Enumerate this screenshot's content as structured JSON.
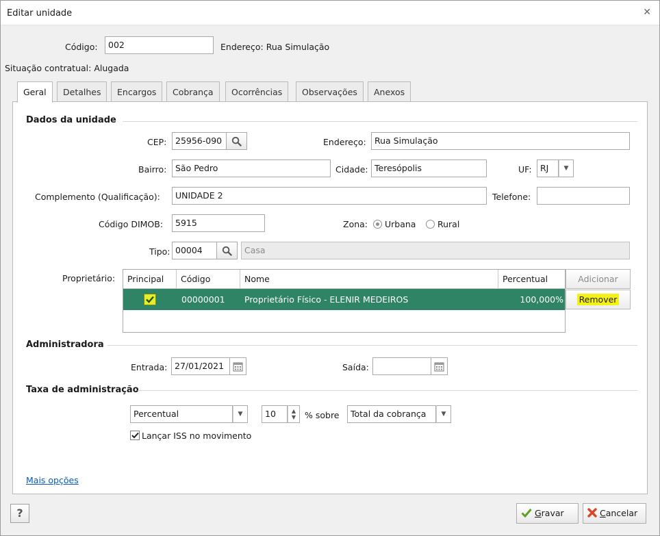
{
  "window": {
    "title": "Editar unidade",
    "close_glyph": "✕"
  },
  "header": {
    "codigo_label": "Código:",
    "codigo_value": "002",
    "endereco_text": "Endereço: Rua Simulação",
    "situacao_text": "Situação contratual: Alugada"
  },
  "tabs": [
    {
      "label": "Geral"
    },
    {
      "label": "Detalhes"
    },
    {
      "label": "Encargos"
    },
    {
      "label": "Cobrança"
    },
    {
      "label": "Ocorrências"
    },
    {
      "label": "Observações"
    },
    {
      "label": "Anexos"
    }
  ],
  "dados": {
    "section_title": "Dados da unidade",
    "cep_label": "CEP:",
    "cep_value": "25956-090",
    "endereco_label": "Endereço:",
    "endereco_value": "Rua Simulação",
    "bairro_label": "Bairro:",
    "bairro_value": "São Pedro",
    "cidade_label": "Cidade:",
    "cidade_value": "Teresópolis",
    "uf_label": "UF:",
    "uf_value": "RJ",
    "complemento_label": "Complemento (Qualificação):",
    "complemento_value": "UNIDADE 2",
    "telefone_label": "Telefone:",
    "telefone_value": "",
    "dimob_label": "Código DIMOB:",
    "dimob_value": "5915",
    "zona_label": "Zona:",
    "zona_urbana": "Urbana",
    "zona_rural": "Rural",
    "tipo_label": "Tipo:",
    "tipo_code": "00004",
    "tipo_desc": "Casa"
  },
  "proprietario": {
    "label": "Proprietário:",
    "columns": [
      "Principal",
      "Código",
      "Nome",
      "Percentual"
    ],
    "rows": [
      {
        "codigo": "00000001",
        "nome": "Proprietário Físico - ELENIR MEDEIROS",
        "percentual": "100,000%",
        "principal": true
      }
    ],
    "add_button": "Adicionar",
    "remove_button": "Remover"
  },
  "administradora": {
    "section_title": "Administradora",
    "entrada_label": "Entrada:",
    "entrada_value": "27/01/2021",
    "saida_label": "Saída:",
    "saida_value": ""
  },
  "taxa": {
    "section_title": "Taxa de administração",
    "tipo_value": "Percentual",
    "valor": "10",
    "sobre_label": "% sobre",
    "base_value": "Total da cobrança",
    "iss_label": "Lançar ISS no movimento"
  },
  "mais_opcoes": "Mais opções",
  "footer": {
    "help": "?",
    "gravar": "Gravar",
    "gravar_rest": "ravar",
    "gravar_key": "G",
    "cancelar_key": "C",
    "cancelar_rest": "ancelar"
  }
}
